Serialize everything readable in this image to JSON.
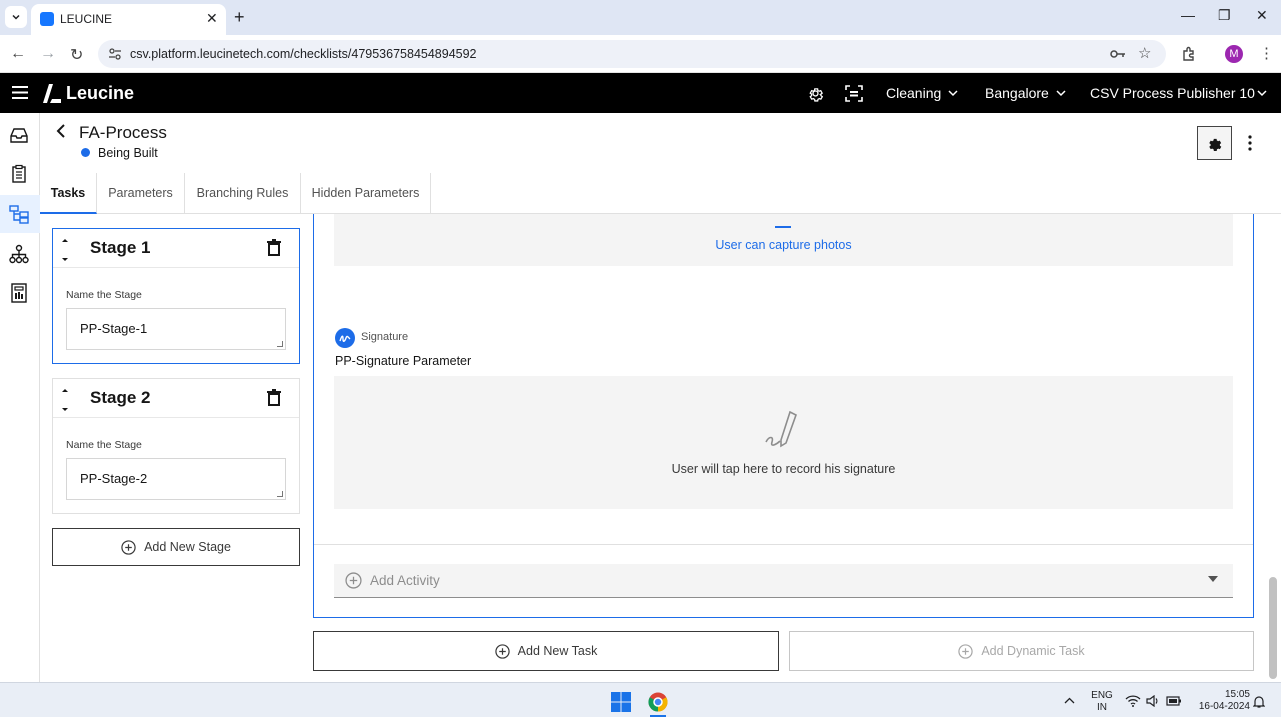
{
  "browser": {
    "tab_title": "LEUCINE",
    "url": "csv.platform.leucinetech.com/checklists/479536758454894592",
    "profile_initial": "M"
  },
  "app": {
    "logo": "Leucine",
    "facility": "Cleaning",
    "site": "Bangalore",
    "user_role": "CSV Process Publisher 10"
  },
  "page": {
    "title": "FA-Process",
    "status": "Being Built",
    "status_color": "#1d6ce8"
  },
  "tabs": [
    {
      "label": "Tasks",
      "active": true
    },
    {
      "label": "Parameters",
      "active": false
    },
    {
      "label": "Branching Rules",
      "active": false
    },
    {
      "label": "Hidden Parameters",
      "active": false
    }
  ],
  "stages": [
    {
      "name": "Stage 1",
      "field_label": "Name the Stage",
      "value": "PP-Stage-1"
    },
    {
      "name": "Stage 2",
      "field_label": "Name the Stage",
      "value": "PP-Stage-2"
    }
  ],
  "add_stage_label": "Add New Stage",
  "task": {
    "photo_hint": "User can capture photos",
    "signature": {
      "type_label": "Signature",
      "parameter_label": "PP-Signature Parameter",
      "hint": "User will tap here to record his signature"
    },
    "add_activity_label": "Add Activity"
  },
  "buttons": {
    "add_task": "Add New Task",
    "add_dynamic_task": "Add Dynamic Task"
  },
  "taskbar": {
    "lang_line1": "ENG",
    "lang_line2": "IN",
    "time": "15:05",
    "date": "16-04-2024"
  }
}
